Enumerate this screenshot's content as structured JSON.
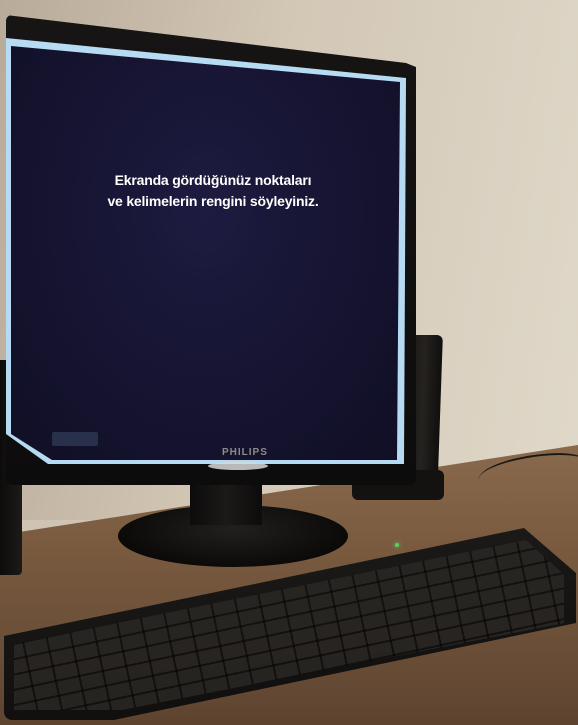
{
  "screen": {
    "lines": [
      "Ekranda gördüğünüz noktaları",
      "ve kelimelerin rengini söyleyiniz."
    ]
  },
  "monitor": {
    "brand": "PHILIPS"
  },
  "colors": {
    "screen_background": "#15132f",
    "screen_border": "#bfe6ff",
    "text": "#ffffff",
    "keyboard_led": "#5bd15f"
  },
  "icons": {
    "keyboard_led": "green-led-indicator"
  }
}
